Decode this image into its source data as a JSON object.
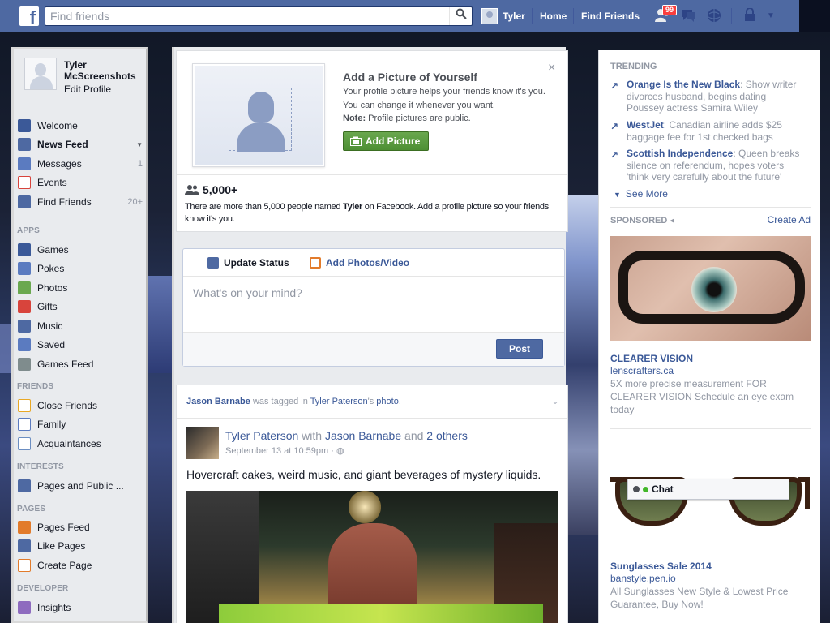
{
  "topbar": {
    "search_placeholder": "Find friends",
    "user_name": "Tyler",
    "nav_home": "Home",
    "nav_find_friends": "Find Friends",
    "friend_requests_count": "99",
    "icons": [
      "facebook-logo-icon",
      "search-icon",
      "friend-requests-icon",
      "messages-icon",
      "notifications-icon",
      "privacy-shortcuts-icon",
      "account-menu-chevron-icon"
    ]
  },
  "sidebar": {
    "profile_name": "Tyler McScreenshots",
    "edit_profile": "Edit Profile",
    "favorites": [
      {
        "label": "Welcome",
        "icon": "facebook-icon",
        "color": "#3b5998"
      },
      {
        "label": "News Feed",
        "icon": "news-feed-icon",
        "color": "#4e69a2",
        "bold": true
      },
      {
        "label": "Messages",
        "icon": "messages-icon",
        "color": "#5b7bc0",
        "count": "1"
      },
      {
        "label": "Events",
        "icon": "calendar-icon",
        "color": "#d8443c"
      },
      {
        "label": "Find Friends",
        "icon": "find-friends-icon",
        "color": "#4e69a2",
        "count": "20+"
      }
    ],
    "apps_heading": "APPS",
    "apps": [
      {
        "label": "Games",
        "icon": "games-icon",
        "color": "#3b5998"
      },
      {
        "label": "Pokes",
        "icon": "poke-icon",
        "color": "#5b7bc0"
      },
      {
        "label": "Photos",
        "icon": "photos-icon",
        "color": "#6aa84f"
      },
      {
        "label": "Gifts",
        "icon": "gift-icon",
        "color": "#d8443c"
      },
      {
        "label": "Music",
        "icon": "music-icon",
        "color": "#4e69a2"
      },
      {
        "label": "Saved",
        "icon": "saved-bookmark-icon",
        "color": "#5b7bc0"
      },
      {
        "label": "Games Feed",
        "icon": "games-feed-controller-icon",
        "color": "#7f8c8d"
      }
    ],
    "friends_heading": "FRIENDS",
    "friends": [
      {
        "label": "Close Friends",
        "icon": "close-friends-star-icon",
        "color": "#e9a825"
      },
      {
        "label": "Family",
        "icon": "family-icon",
        "color": "#5b7bc0"
      },
      {
        "label": "Acquaintances",
        "icon": "acquaintances-icon",
        "color": "#6b8ec2"
      }
    ],
    "interests_heading": "INTERESTS",
    "interests": [
      {
        "label": "Pages and Public ...",
        "icon": "pages-list-icon",
        "color": "#4e69a2"
      }
    ],
    "pages_heading": "PAGES",
    "pages": [
      {
        "label": "Pages Feed",
        "icon": "pages-feed-flag-icon",
        "color": "#e27b2b"
      },
      {
        "label": "Like Pages",
        "icon": "like-thumb-icon",
        "color": "#4e69a2"
      },
      {
        "label": "Create Page",
        "icon": "create-page-icon",
        "color": "#e27b2b"
      }
    ],
    "developer_heading": "DEVELOPER",
    "developer": [
      {
        "label": "Insights",
        "icon": "insights-chart-icon",
        "color": "#8e6bbf"
      }
    ]
  },
  "profile_prompt": {
    "title": "Add a Picture of Yourself",
    "description": "Your profile picture helps your friends know it's you. You can change it whenever you want.",
    "note_label": "Note:",
    "note_text": "Profile pictures are public.",
    "button": "Add Picture",
    "close": "×",
    "count": "5,000+",
    "count_desc_pre": "There are more than 5,000 people named",
    "count_desc_name": "Tyler",
    "count_desc_post": "on Facebook. Add a profile picture so your friends know it's you."
  },
  "composer": {
    "tab_status": "Update Status",
    "tab_photo": "Add Photos/Video",
    "placeholder": "What's on your mind?",
    "post_button": "Post"
  },
  "story": {
    "actor": "Jason Barnabe",
    "verb": "was tagged in",
    "owner": "Tyler Paterson",
    "owner_suffix": "'s",
    "object": "photo",
    "object_suffix": ".",
    "author": "Tyler Paterson",
    "with_word": "with",
    "with_name": "Jason Barnabe",
    "and_word": "and",
    "others": "2 others",
    "timestamp": "September 13 at 10:59pm",
    "meta_sep": "·",
    "text": "Hovercraft cakes, weird music, and giant beverages of mystery liquids."
  },
  "trending": {
    "heading": "TRENDING",
    "items": [
      {
        "name": "Orange Is the New Black",
        "desc": ": Show writer divorces husband, begins dating Poussey actress Samira Wiley"
      },
      {
        "name": "WestJet",
        "desc": ": Canadian airline adds $25 baggage fee for 1st checked bags"
      },
      {
        "name": "Scottish Independence",
        "desc": ": Queen breaks silence on referendum, hopes voters 'think very carefully about the future'"
      }
    ],
    "see_more": "See More"
  },
  "sponsored": {
    "heading": "SPONSORED",
    "create_ad": "Create Ad",
    "ads": [
      {
        "title": "CLEARER VISION",
        "url": "lenscrafters.ca",
        "desc": "5X more precise measurement FOR CLEARER VISION Schedule an eye exam today"
      },
      {
        "title": "Sunglasses Sale 2014",
        "url": "banstyle.pen.io",
        "desc": "All Sunglasses New Style & Lowest Price Guarantee, Buy Now!"
      }
    ]
  },
  "chat": {
    "label": "Chat"
  }
}
